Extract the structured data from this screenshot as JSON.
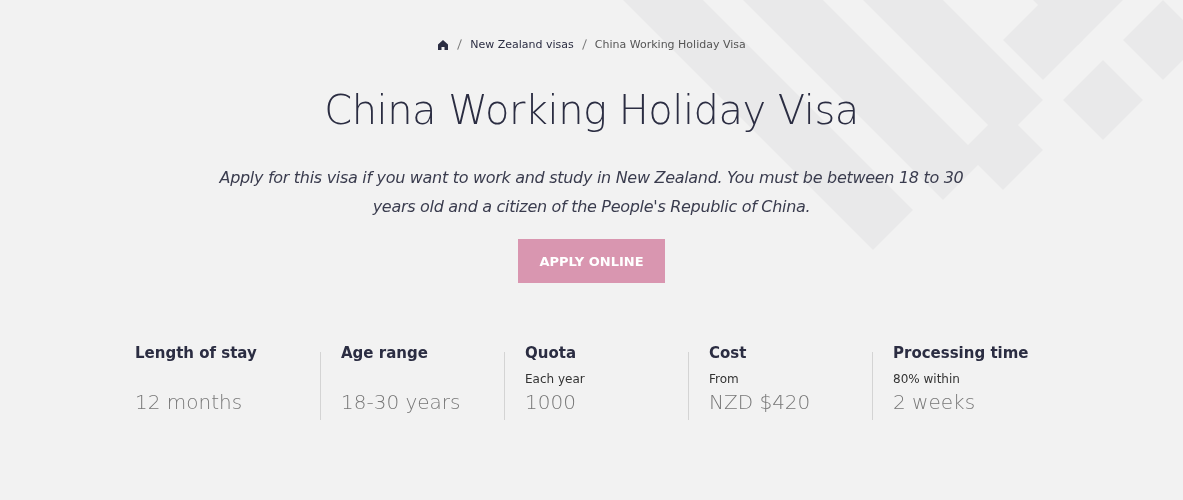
{
  "breadcrumb": [
    {
      "kind": "home"
    },
    {
      "kind": "link",
      "label": "New Zealand visas"
    },
    {
      "kind": "current",
      "label": "China Working Holiday Visa"
    }
  ],
  "title": "China Working Holiday Visa",
  "intro": "Apply for this visa if you want to work and study in New Zealand. You must be between 18 to 30 years old and a citizen of the People's Republic of China.",
  "apply_button": {
    "label": "APPLY ONLINE",
    "disabled": true
  },
  "facts": [
    {
      "label": "Length of stay",
      "value": "12 months"
    },
    {
      "label": "Age range",
      "value": "18-30 years"
    },
    {
      "label": "Quota",
      "note": "Each year",
      "value": "1000"
    },
    {
      "label": "Cost",
      "note": "From",
      "value": "NZD $420"
    },
    {
      "label": "Processing time",
      "note": "80% within",
      "value": "2 weeks"
    }
  ]
}
